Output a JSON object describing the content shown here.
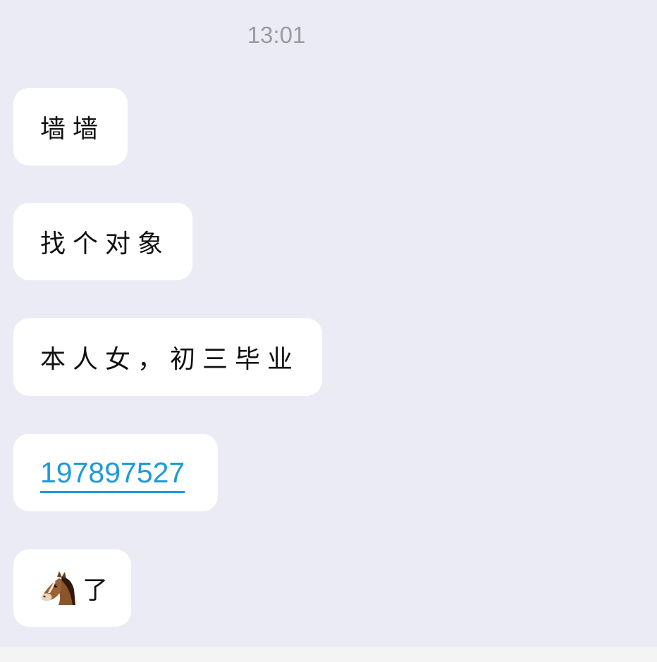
{
  "chat": {
    "timestamp": "13:01",
    "messages": [
      {
        "text": "墙墙"
      },
      {
        "text": "找个对象"
      },
      {
        "text": "本人女，初三毕业"
      },
      {
        "text": "197897527",
        "type": "link"
      },
      {
        "emoji": "horse-face",
        "text": "了"
      }
    ]
  },
  "colors": {
    "background": "#ebebf5",
    "bubble": "#ffffff",
    "link": "#1e9bd7",
    "timestamp": "#9a9aa2"
  }
}
